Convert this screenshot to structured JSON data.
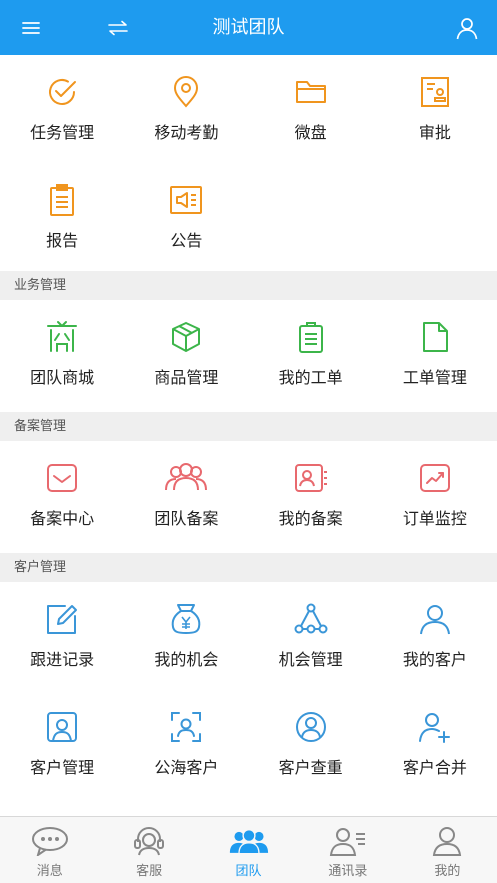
{
  "header": {
    "title": "测试团队"
  },
  "sections": {
    "top": {
      "items": [
        {
          "label": "任务管理",
          "icon": "task-check-icon"
        },
        {
          "label": "移动考勤",
          "icon": "location-pin-icon"
        },
        {
          "label": "微盘",
          "icon": "folder-icon"
        },
        {
          "label": "审批",
          "icon": "approval-stamp-icon"
        },
        {
          "label": "报告",
          "icon": "report-clipboard-icon"
        },
        {
          "label": "公告",
          "icon": "megaphone-icon"
        }
      ]
    },
    "business": {
      "label": "业务管理",
      "items": [
        {
          "label": "团队商城",
          "icon": "shop-icon"
        },
        {
          "label": "商品管理",
          "icon": "box-icon"
        },
        {
          "label": "我的工单",
          "icon": "work-order-icon"
        },
        {
          "label": "工单管理",
          "icon": "document-icon"
        }
      ]
    },
    "filing": {
      "label": "备案管理",
      "items": [
        {
          "label": "备案中心",
          "icon": "filing-center-icon"
        },
        {
          "label": "团队备案",
          "icon": "team-people-icon"
        },
        {
          "label": "我的备案",
          "icon": "id-card-icon"
        },
        {
          "label": "订单监控",
          "icon": "trend-chart-icon"
        }
      ]
    },
    "customer": {
      "label": "客户管理",
      "items": [
        {
          "label": "跟进记录",
          "icon": "edit-note-icon"
        },
        {
          "label": "我的机会",
          "icon": "money-bag-icon"
        },
        {
          "label": "机会管理",
          "icon": "network-nodes-icon"
        },
        {
          "label": "我的客户",
          "icon": "person-icon"
        },
        {
          "label": "客户管理",
          "icon": "person-frame-icon"
        },
        {
          "label": "公海客户",
          "icon": "scan-person-icon"
        },
        {
          "label": "客户查重",
          "icon": "person-circle-icon"
        },
        {
          "label": "客户合并",
          "icon": "person-add-icon"
        }
      ]
    }
  },
  "tabbar": {
    "tabs": [
      {
        "label": "消息",
        "icon": "message-bubble-icon",
        "active": false
      },
      {
        "label": "客服",
        "icon": "headset-icon",
        "active": false
      },
      {
        "label": "团队",
        "icon": "team-icon",
        "active": true
      },
      {
        "label": "通讯录",
        "icon": "contacts-icon",
        "active": false
      },
      {
        "label": "我的",
        "icon": "profile-icon",
        "active": false
      }
    ]
  },
  "colors": {
    "header": "#1e9bef",
    "orange": "#f0951e",
    "green": "#3cb54a",
    "red": "#e8696e",
    "blue": "#3a96d8",
    "active_tab": "#1e9bef"
  }
}
